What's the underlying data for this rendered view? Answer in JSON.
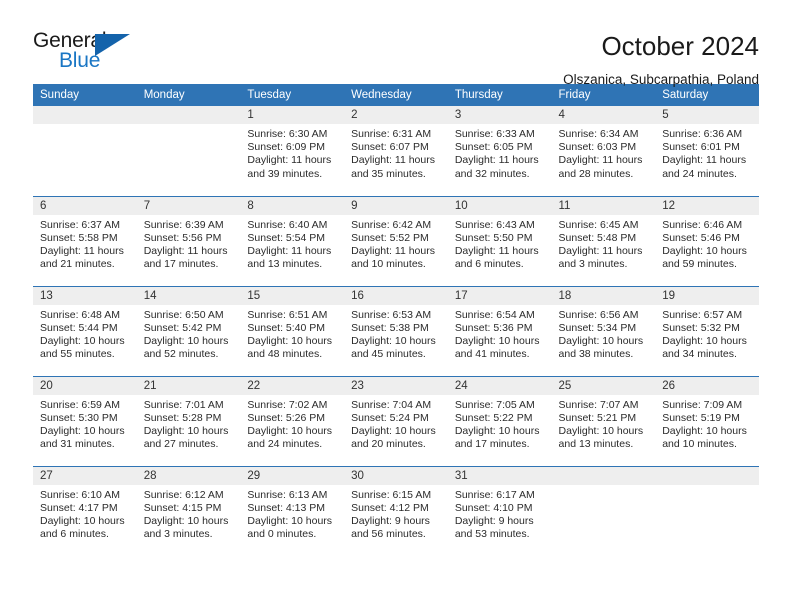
{
  "logo": {
    "word1": "General",
    "word2": "Blue",
    "triangle_color": "#1463ab",
    "blue_color": "#1a76c4"
  },
  "header": {
    "title": "October 2024",
    "subtitle": "Olszanica, Subcarpathia, Poland"
  },
  "theme": {
    "header_blue": "#2f74b5",
    "day_band_gray": "#eeeeee"
  },
  "weekday_headers": [
    "Sunday",
    "Monday",
    "Tuesday",
    "Wednesday",
    "Thursday",
    "Friday",
    "Saturday"
  ],
  "labels": {
    "sunrise_prefix": "Sunrise:",
    "sunset_prefix": "Sunset:",
    "daylight_prefix": "Daylight:"
  },
  "weeks": [
    [
      {
        "day": "",
        "empty": true
      },
      {
        "day": "",
        "empty": true
      },
      {
        "day": "1",
        "sunrise": "Sunrise: 6:30 AM",
        "sunset": "Sunset: 6:09 PM",
        "daylight_line1": "Daylight: 11 hours",
        "daylight_line2": "and 39 minutes."
      },
      {
        "day": "2",
        "sunrise": "Sunrise: 6:31 AM",
        "sunset": "Sunset: 6:07 PM",
        "daylight_line1": "Daylight: 11 hours",
        "daylight_line2": "and 35 minutes."
      },
      {
        "day": "3",
        "sunrise": "Sunrise: 6:33 AM",
        "sunset": "Sunset: 6:05 PM",
        "daylight_line1": "Daylight: 11 hours",
        "daylight_line2": "and 32 minutes."
      },
      {
        "day": "4",
        "sunrise": "Sunrise: 6:34 AM",
        "sunset": "Sunset: 6:03 PM",
        "daylight_line1": "Daylight: 11 hours",
        "daylight_line2": "and 28 minutes."
      },
      {
        "day": "5",
        "sunrise": "Sunrise: 6:36 AM",
        "sunset": "Sunset: 6:01 PM",
        "daylight_line1": "Daylight: 11 hours",
        "daylight_line2": "and 24 minutes."
      }
    ],
    [
      {
        "day": "6",
        "sunrise": "Sunrise: 6:37 AM",
        "sunset": "Sunset: 5:58 PM",
        "daylight_line1": "Daylight: 11 hours",
        "daylight_line2": "and 21 minutes."
      },
      {
        "day": "7",
        "sunrise": "Sunrise: 6:39 AM",
        "sunset": "Sunset: 5:56 PM",
        "daylight_line1": "Daylight: 11 hours",
        "daylight_line2": "and 17 minutes."
      },
      {
        "day": "8",
        "sunrise": "Sunrise: 6:40 AM",
        "sunset": "Sunset: 5:54 PM",
        "daylight_line1": "Daylight: 11 hours",
        "daylight_line2": "and 13 minutes."
      },
      {
        "day": "9",
        "sunrise": "Sunrise: 6:42 AM",
        "sunset": "Sunset: 5:52 PM",
        "daylight_line1": "Daylight: 11 hours",
        "daylight_line2": "and 10 minutes."
      },
      {
        "day": "10",
        "sunrise": "Sunrise: 6:43 AM",
        "sunset": "Sunset: 5:50 PM",
        "daylight_line1": "Daylight: 11 hours",
        "daylight_line2": "and 6 minutes."
      },
      {
        "day": "11",
        "sunrise": "Sunrise: 6:45 AM",
        "sunset": "Sunset: 5:48 PM",
        "daylight_line1": "Daylight: 11 hours",
        "daylight_line2": "and 3 minutes."
      },
      {
        "day": "12",
        "sunrise": "Sunrise: 6:46 AM",
        "sunset": "Sunset: 5:46 PM",
        "daylight_line1": "Daylight: 10 hours",
        "daylight_line2": "and 59 minutes."
      }
    ],
    [
      {
        "day": "13",
        "sunrise": "Sunrise: 6:48 AM",
        "sunset": "Sunset: 5:44 PM",
        "daylight_line1": "Daylight: 10 hours",
        "daylight_line2": "and 55 minutes."
      },
      {
        "day": "14",
        "sunrise": "Sunrise: 6:50 AM",
        "sunset": "Sunset: 5:42 PM",
        "daylight_line1": "Daylight: 10 hours",
        "daylight_line2": "and 52 minutes."
      },
      {
        "day": "15",
        "sunrise": "Sunrise: 6:51 AM",
        "sunset": "Sunset: 5:40 PM",
        "daylight_line1": "Daylight: 10 hours",
        "daylight_line2": "and 48 minutes."
      },
      {
        "day": "16",
        "sunrise": "Sunrise: 6:53 AM",
        "sunset": "Sunset: 5:38 PM",
        "daylight_line1": "Daylight: 10 hours",
        "daylight_line2": "and 45 minutes."
      },
      {
        "day": "17",
        "sunrise": "Sunrise: 6:54 AM",
        "sunset": "Sunset: 5:36 PM",
        "daylight_line1": "Daylight: 10 hours",
        "daylight_line2": "and 41 minutes."
      },
      {
        "day": "18",
        "sunrise": "Sunrise: 6:56 AM",
        "sunset": "Sunset: 5:34 PM",
        "daylight_line1": "Daylight: 10 hours",
        "daylight_line2": "and 38 minutes."
      },
      {
        "day": "19",
        "sunrise": "Sunrise: 6:57 AM",
        "sunset": "Sunset: 5:32 PM",
        "daylight_line1": "Daylight: 10 hours",
        "daylight_line2": "and 34 minutes."
      }
    ],
    [
      {
        "day": "20",
        "sunrise": "Sunrise: 6:59 AM",
        "sunset": "Sunset: 5:30 PM",
        "daylight_line1": "Daylight: 10 hours",
        "daylight_line2": "and 31 minutes."
      },
      {
        "day": "21",
        "sunrise": "Sunrise: 7:01 AM",
        "sunset": "Sunset: 5:28 PM",
        "daylight_line1": "Daylight: 10 hours",
        "daylight_line2": "and 27 minutes."
      },
      {
        "day": "22",
        "sunrise": "Sunrise: 7:02 AM",
        "sunset": "Sunset: 5:26 PM",
        "daylight_line1": "Daylight: 10 hours",
        "daylight_line2": "and 24 minutes."
      },
      {
        "day": "23",
        "sunrise": "Sunrise: 7:04 AM",
        "sunset": "Sunset: 5:24 PM",
        "daylight_line1": "Daylight: 10 hours",
        "daylight_line2": "and 20 minutes."
      },
      {
        "day": "24",
        "sunrise": "Sunrise: 7:05 AM",
        "sunset": "Sunset: 5:22 PM",
        "daylight_line1": "Daylight: 10 hours",
        "daylight_line2": "and 17 minutes."
      },
      {
        "day": "25",
        "sunrise": "Sunrise: 7:07 AM",
        "sunset": "Sunset: 5:21 PM",
        "daylight_line1": "Daylight: 10 hours",
        "daylight_line2": "and 13 minutes."
      },
      {
        "day": "26",
        "sunrise": "Sunrise: 7:09 AM",
        "sunset": "Sunset: 5:19 PM",
        "daylight_line1": "Daylight: 10 hours",
        "daylight_line2": "and 10 minutes."
      }
    ],
    [
      {
        "day": "27",
        "sunrise": "Sunrise: 6:10 AM",
        "sunset": "Sunset: 4:17 PM",
        "daylight_line1": "Daylight: 10 hours",
        "daylight_line2": "and 6 minutes."
      },
      {
        "day": "28",
        "sunrise": "Sunrise: 6:12 AM",
        "sunset": "Sunset: 4:15 PM",
        "daylight_line1": "Daylight: 10 hours",
        "daylight_line2": "and 3 minutes."
      },
      {
        "day": "29",
        "sunrise": "Sunrise: 6:13 AM",
        "sunset": "Sunset: 4:13 PM",
        "daylight_line1": "Daylight: 10 hours",
        "daylight_line2": "and 0 minutes."
      },
      {
        "day": "30",
        "sunrise": "Sunrise: 6:15 AM",
        "sunset": "Sunset: 4:12 PM",
        "daylight_line1": "Daylight: 9 hours",
        "daylight_line2": "and 56 minutes."
      },
      {
        "day": "31",
        "sunrise": "Sunrise: 6:17 AM",
        "sunset": "Sunset: 4:10 PM",
        "daylight_line1": "Daylight: 9 hours",
        "daylight_line2": "and 53 minutes."
      },
      {
        "day": "",
        "empty": true
      },
      {
        "day": "",
        "empty": true
      }
    ]
  ]
}
